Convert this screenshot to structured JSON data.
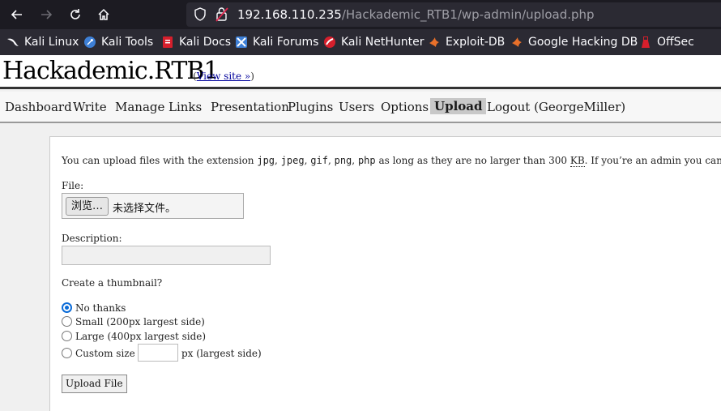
{
  "browser": {
    "url_host": "192.168.110.235",
    "url_path": "/Hackademic_RTB1/wp-admin/upload.php",
    "bookmarks": [
      {
        "label": "Kali Linux",
        "icon": "kali-dragon-icon"
      },
      {
        "label": "Kali Tools",
        "icon": "kali-tools-icon"
      },
      {
        "label": "Kali Docs",
        "icon": "kali-docs-icon"
      },
      {
        "label": "Kali Forums",
        "icon": "kali-forums-icon"
      },
      {
        "label": "Kali NetHunter",
        "icon": "kali-nethunter-icon"
      },
      {
        "label": "Exploit-DB",
        "icon": "exploit-db-icon"
      },
      {
        "label": "Google Hacking DB",
        "icon": "ghdb-icon"
      },
      {
        "label": "OffSec",
        "icon": "offsec-icon"
      }
    ]
  },
  "header": {
    "site_title": "Hackademic.RTB1",
    "view_site_open": "(",
    "view_site_link": "View site »",
    "view_site_close": ")"
  },
  "menu": {
    "dashboard": "Dashboard",
    "write": "Write",
    "manage": "Manage",
    "links": "Links",
    "presentation": "Presentation",
    "plugins": "Plugins",
    "users": "Users",
    "options": "Options",
    "upload": "Upload",
    "logout": "Logout (GeorgeMiller)"
  },
  "upload_form": {
    "intro_prefix": "You can upload files with the extension",
    "ext_jpg": "jpg",
    "ext_jpeg": "jpeg",
    "ext_gif": "gif",
    "ext_png": "png",
    "ext_php": "php",
    "sep": ",",
    "intro_mid": "as long as they are no larger than 300",
    "unit": "KB",
    "intro_suffix": ". If you’re an admin you can configure these v",
    "file_label": "File:",
    "browse_button": "浏览…",
    "no_file": "未选择文件。",
    "description_label": "Description:",
    "description_value": "",
    "thumbnail_label": "Create a thumbnail?",
    "options": [
      {
        "label": "No thanks",
        "checked": true
      },
      {
        "label": "Small (200px largest side)",
        "checked": false
      },
      {
        "label": "Large (400px largest side)",
        "checked": false
      },
      {
        "label": "Custom size :",
        "checked": false
      }
    ],
    "custom_suffix": "px (largest side)",
    "custom_value": "",
    "submit_label": "Upload File"
  },
  "colors": {
    "browser_bg": "#1c1b22",
    "bookmarks_bg": "#2b2a33",
    "link": "#00019b",
    "radio_checked": "#0a6bd8"
  }
}
